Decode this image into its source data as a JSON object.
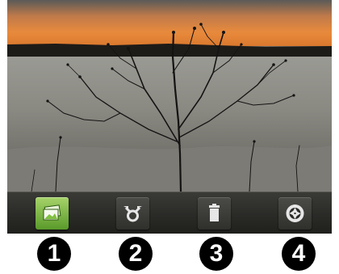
{
  "toolbar": {
    "buttons": [
      {
        "icon": "gallery-icon",
        "active": true
      },
      {
        "icon": "share-icon",
        "active": false
      },
      {
        "icon": "trash-icon",
        "active": false
      },
      {
        "icon": "camera-icon",
        "active": false
      }
    ],
    "accent_color": "#7fbf3f"
  },
  "callouts": [
    "1",
    "2",
    "3",
    "4"
  ]
}
